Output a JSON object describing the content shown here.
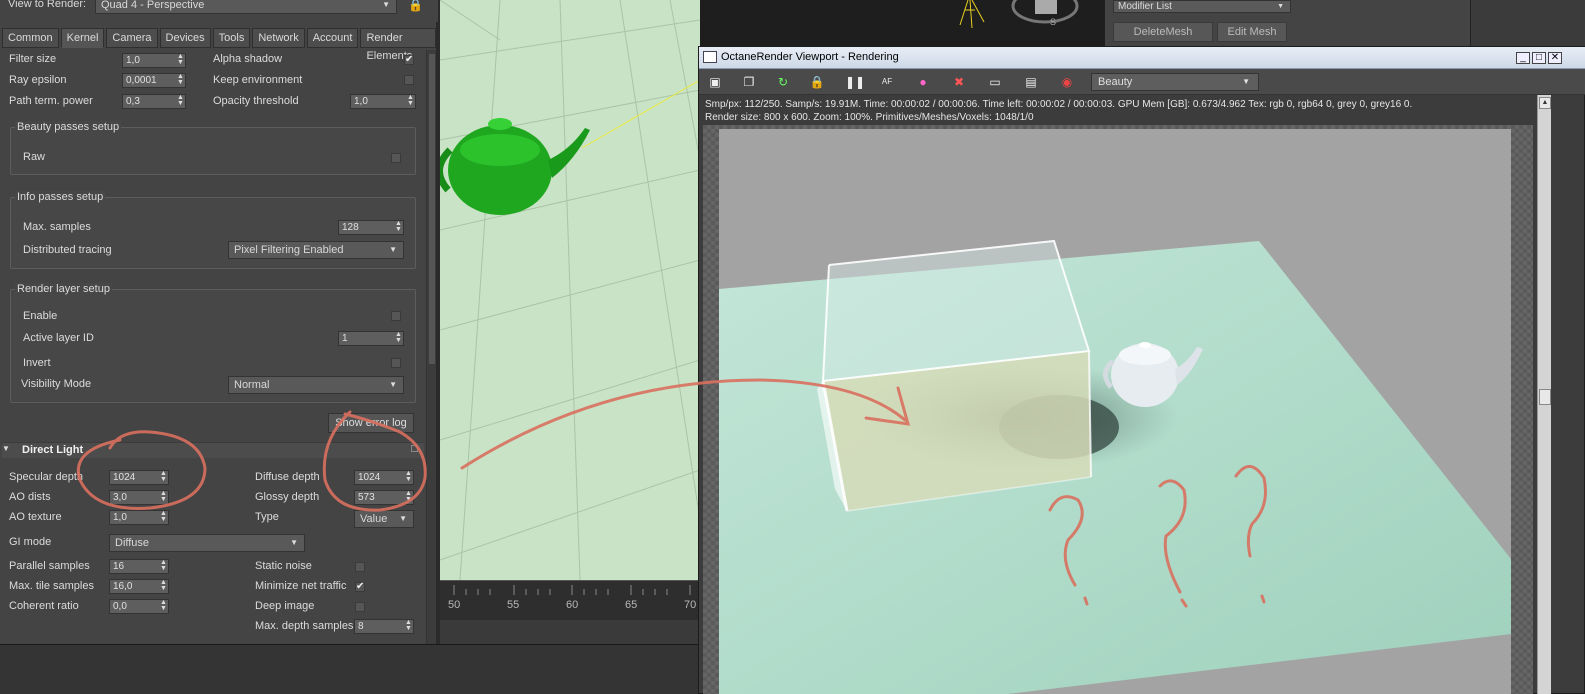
{
  "view_to_render": {
    "label": "View to Render:",
    "value": "Quad 4 - Perspective"
  },
  "tabs": [
    "Common",
    "Kernel",
    "Camera",
    "Devices",
    "Tools",
    "Network",
    "Account",
    "Render Elements"
  ],
  "active_tab": "Kernel",
  "kernel": {
    "filter_size": {
      "label": "Filter size",
      "value": "1,0"
    },
    "alpha_shadow": {
      "label": "Alpha shadow",
      "checked": true
    },
    "ray_epsilon": {
      "label": "Ray epsilon",
      "value": "0,0001"
    },
    "keep_environment": {
      "label": "Keep environment",
      "checked": false
    },
    "path_term_power": {
      "label": "Path term. power",
      "value": "0,3"
    },
    "opacity_threshold": {
      "label": "Opacity threshold",
      "value": "1,0"
    }
  },
  "beauty_passes": {
    "title": "Beauty passes setup",
    "raw": {
      "label": "Raw",
      "checked": false
    }
  },
  "info_passes": {
    "title": "Info passes setup",
    "max_samples": {
      "label": "Max. samples",
      "value": "128"
    },
    "distributed_tracing": {
      "label": "Distributed tracing",
      "value": "Pixel Filtering Enabled"
    }
  },
  "render_layer": {
    "title": "Render layer setup",
    "enable": {
      "label": "Enable",
      "checked": false
    },
    "active_layer_id": {
      "label": "Active layer ID",
      "value": "1"
    },
    "invert": {
      "label": "Invert",
      "checked": false
    },
    "visibility_mode": {
      "label": "Visibility Mode",
      "value": "Normal"
    }
  },
  "show_error_log": "Show error log",
  "direct_light": {
    "title": "Direct Light",
    "specular_depth": {
      "label": "Specular depth",
      "value": "1024"
    },
    "diffuse_depth": {
      "label": "Diffuse depth",
      "value": "1024"
    },
    "ao_dists": {
      "label": "AO dists",
      "value": "3,0"
    },
    "glossy_depth": {
      "label": "Glossy depth",
      "value": "573"
    },
    "ao_texture": {
      "label": "AO texture",
      "value": "1,0"
    },
    "type": {
      "label": "Type",
      "value": "Value"
    },
    "gi_mode": {
      "label": "GI mode",
      "value": "Diffuse"
    },
    "parallel_samples": {
      "label": "Parallel samples",
      "value": "16"
    },
    "static_noise": {
      "label": "Static noise",
      "checked": false
    },
    "max_tile_samples": {
      "label": "Max. tile samples",
      "value": "16,0"
    },
    "minimize_net_traffic": {
      "label": "Minimize net traffic",
      "checked": true
    },
    "coherent_ratio": {
      "label": "Coherent ratio",
      "value": "0,0"
    },
    "deep_image": {
      "label": "Deep image",
      "checked": false
    },
    "max_depth_samples": {
      "label": "Max. depth samples",
      "value": "8"
    }
  },
  "ruler_ticks": [
    "50",
    "55",
    "60",
    "65",
    "70"
  ],
  "modifier": {
    "list": "Modifier List",
    "delete_mesh": "DeleteMesh",
    "edit_mesh": "Edit Mesh"
  },
  "compass_label": "S",
  "octane": {
    "title": "OctaneRender Viewport - Rendering",
    "pass": "Beauty",
    "status_line1": "Smp/px: 112/250.   Samp/s: 19.91M.   Time: 00:00:02 / 00:00:06.   Time left: 00:00:02 / 00:00:03.   GPU Mem [GB]: 0.673/4.962   Tex: rgb 0, rgb64 0, grey 0, grey16 0.",
    "status_line2": "Render size: 800 x 600.   Zoom: 100%.   Primitives/Meshes/Voxels: 1048/1/0"
  },
  "colors": {
    "panel_bg": "#444444",
    "viewport_green": "#c9e3c6",
    "annotation_red": "#d9705f",
    "floor_mint": "#b4dccd"
  }
}
